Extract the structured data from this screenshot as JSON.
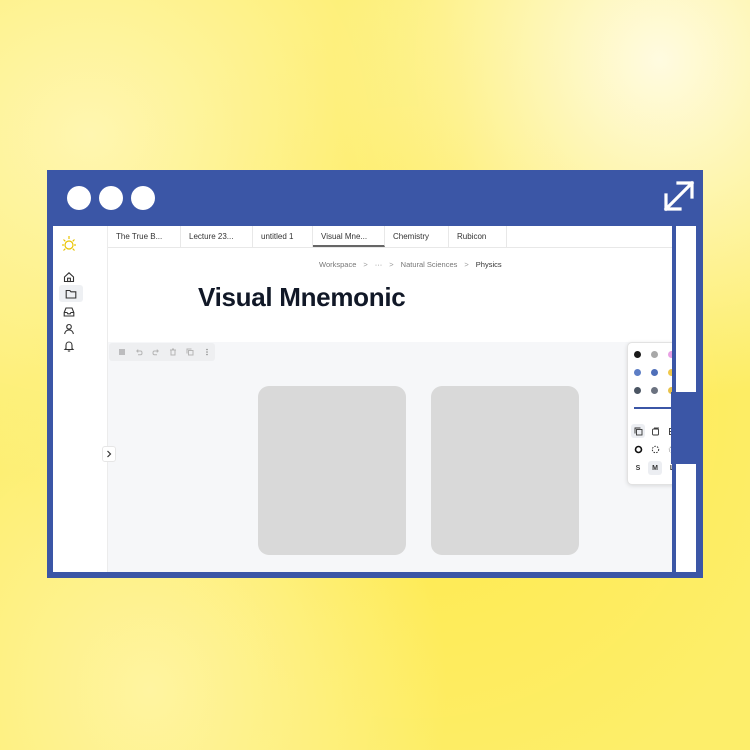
{
  "window": {
    "controls": [
      "close",
      "minimize",
      "maximize"
    ],
    "expand_icon": "expand-arrows-icon",
    "frame_color": "#3b56a6"
  },
  "sidebar": {
    "logo_icon": "sun-logo-icon",
    "items": [
      {
        "name": "home",
        "icon": "home-icon"
      },
      {
        "name": "files",
        "icon": "folder-icon",
        "active": true
      },
      {
        "name": "inbox",
        "icon": "inbox-icon"
      },
      {
        "name": "profile",
        "icon": "user-icon"
      },
      {
        "name": "notifications",
        "icon": "bell-icon"
      }
    ]
  },
  "tabs": [
    {
      "label": "The True B..."
    },
    {
      "label": "Lecture 23..."
    },
    {
      "label": "untitled 1"
    },
    {
      "label": "Visual Mne...",
      "active": true
    },
    {
      "label": "Chemistry"
    },
    {
      "label": "Rubicon"
    }
  ],
  "breadcrumb": {
    "items": [
      "Workspace",
      "···",
      "Natural Sciences",
      "Physics"
    ],
    "separator": ">"
  },
  "page": {
    "title": "Visual Mnemonic"
  },
  "toolbar": {
    "items": [
      "list-icon",
      "undo-icon",
      "redo-icon",
      "delete-icon",
      "copy-icon",
      "more-icon"
    ]
  },
  "canvas": {
    "cards": 2,
    "card_color": "#d9d9d9"
  },
  "style_panel": {
    "colors": [
      "#1a1a1a",
      "#a8a8a8",
      "#e9a0e4",
      "#5d7ec5",
      "#4f6fb9",
      "#f0c84a",
      "#4b5563",
      "#6b7280",
      "#e8c24a"
    ],
    "accent": "#3b56a6",
    "sizes": [
      "S",
      "M",
      "L"
    ],
    "active_size": "M"
  }
}
